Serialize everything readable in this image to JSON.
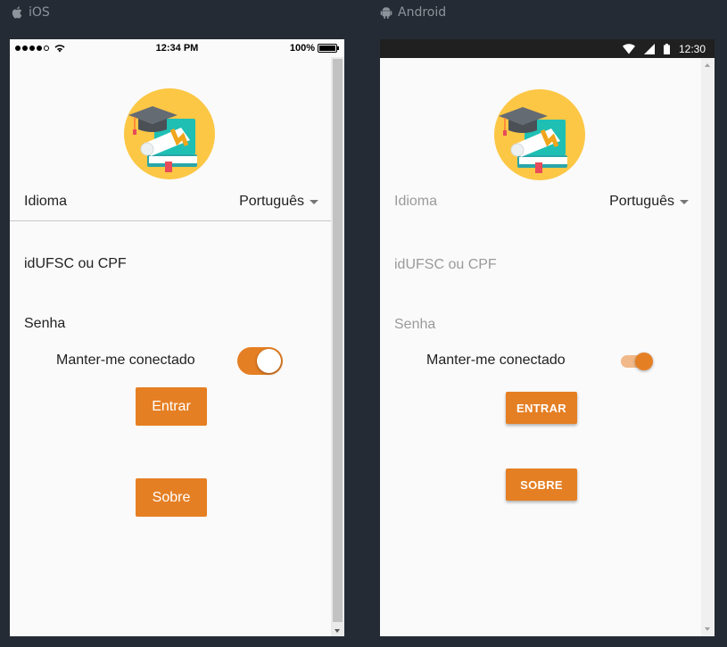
{
  "ios": {
    "platform_label": "iOS",
    "status": {
      "time": "12:34 PM",
      "battery": "100%"
    },
    "language_label": "Idioma",
    "language_value": "Português",
    "user_field_label": "idUFSC ou CPF",
    "password_field_label": "Senha",
    "keep_connected_label": "Manter-me conectado",
    "keep_connected_on": true,
    "login_button": "Entrar",
    "about_button": "Sobre"
  },
  "android": {
    "platform_label": "Android",
    "status": {
      "time": "12:30"
    },
    "language_label": "Idioma",
    "language_value": "Português",
    "user_field_label": "idUFSC ou CPF",
    "password_field_label": "Senha",
    "keep_connected_label": "Manter-me conectado",
    "keep_connected_on": true,
    "login_button": "ENTRAR",
    "about_button": "SOBRE"
  },
  "colors": {
    "accent": "#e57f24",
    "background": "#252b34",
    "screen": "#fafafa"
  },
  "icons": [
    "apple-icon",
    "android-icon",
    "wifi-icon",
    "signal-icon",
    "battery-icon",
    "graduation-books-logo",
    "dropdown-caret-icon"
  ]
}
